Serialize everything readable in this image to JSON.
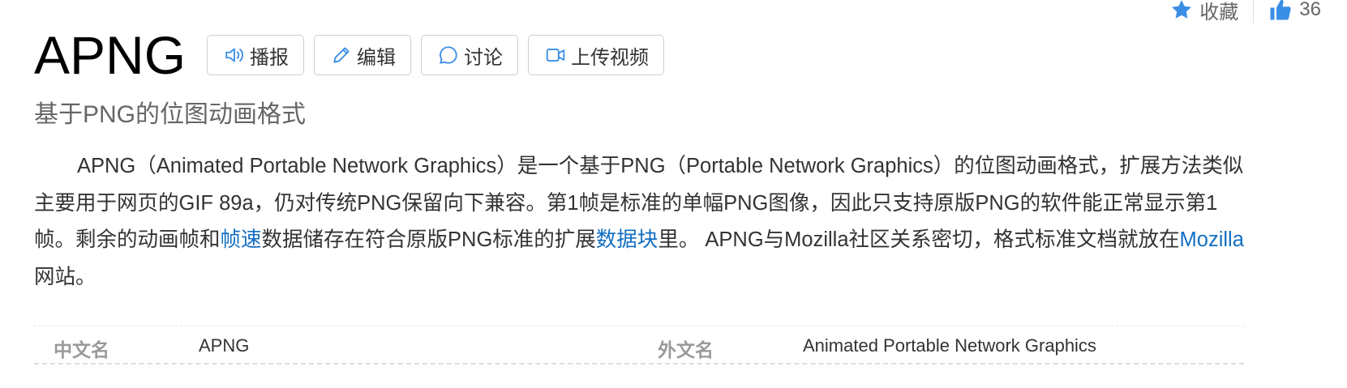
{
  "header": {
    "collect_label": "收藏",
    "like_count": "36"
  },
  "entry": {
    "title": "APNG",
    "subtitle": "基于PNG的位图动画格式"
  },
  "toolbar": {
    "broadcast_label": "播报",
    "edit_label": "编辑",
    "discuss_label": "讨论",
    "upload_video_label": "上传视频"
  },
  "summary": {
    "part1": "APNG（Animated Portable Network Graphics）是一个基于PNG（Portable Network Graphics）的位图动画格式，扩展方法类似主要用于网页的GIF 89a，仍对传统PNG保留向下兼容。第1帧是标准的单幅PNG图像，因此只支持原版PNG的软件能正常显示第1帧。剩余的动画帧和",
    "link1": "帧速",
    "part2": "数据储存在符合原版PNG标准的扩展",
    "link2": "数据块",
    "part3": "里。 APNG与Mozilla社区关系密切，格式标准文档就放在",
    "link3": "Mozilla",
    "part4": "网站。"
  },
  "basic_info": [
    {
      "key": "中文名",
      "value": "APNG"
    },
    {
      "key": "外文名",
      "value": "Animated Portable Network Graphics"
    }
  ],
  "colors": {
    "link": "#136ec2",
    "icon": "#3a8ee6",
    "text": "#333333",
    "muted": "#999999"
  }
}
